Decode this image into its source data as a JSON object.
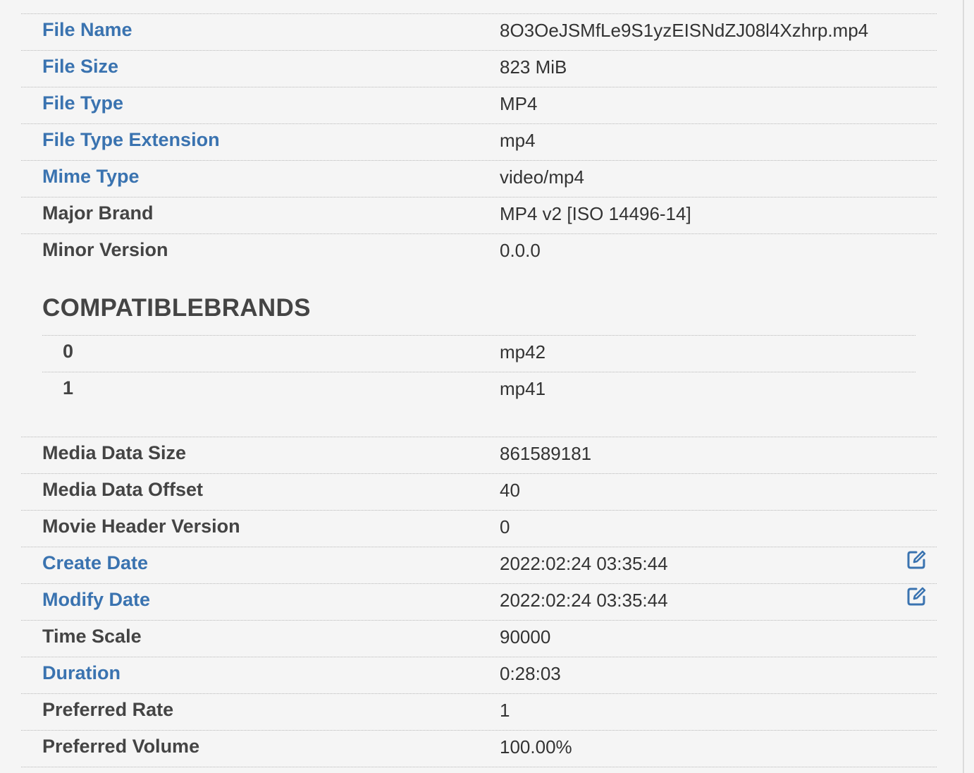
{
  "rows_top": [
    {
      "label": "File Name",
      "value": "8O3OeJSMfLe9S1yzEISNdZJ08l4Xzhrp.mp4",
      "link": true
    },
    {
      "label": "File Size",
      "value": "823 MiB",
      "link": true
    },
    {
      "label": "File Type",
      "value": "MP4",
      "link": true
    },
    {
      "label": "File Type Extension",
      "value": "mp4",
      "link": true
    },
    {
      "label": "Mime Type",
      "value": "video/mp4",
      "link": true
    },
    {
      "label": "Major Brand",
      "value": "MP4 v2 [ISO 14496-14]",
      "link": false
    },
    {
      "label": "Minor Version",
      "value": "0.0.0",
      "link": false
    }
  ],
  "compatible_brands": {
    "title": "COMPATIBLEBRANDS",
    "items": [
      {
        "label": "0",
        "value": "mp42"
      },
      {
        "label": "1",
        "value": "mp41"
      }
    ]
  },
  "rows_bottom": [
    {
      "label": "Media Data Size",
      "value": "861589181",
      "link": false
    },
    {
      "label": "Media Data Offset",
      "value": "40",
      "link": false
    },
    {
      "label": "Movie Header Version",
      "value": "0",
      "link": false
    },
    {
      "label": "Create Date",
      "value": "2022:02:24 03:35:44",
      "link": true,
      "edit_icon": "edit-icon"
    },
    {
      "label": "Modify Date",
      "value": "2022:02:24 03:35:44",
      "link": true,
      "edit_icon": "edit-icon"
    },
    {
      "label": "Time Scale",
      "value": "90000",
      "link": false
    },
    {
      "label": "Duration",
      "value": "0:28:03",
      "link": true
    },
    {
      "label": "Preferred Rate",
      "value": "1",
      "link": false
    },
    {
      "label": "Preferred Volume",
      "value": "100.00%",
      "link": false
    }
  ],
  "colors": {
    "link": "#3a73b0",
    "label": "#444444",
    "value": "#333333",
    "background": "#f5f5f5"
  }
}
